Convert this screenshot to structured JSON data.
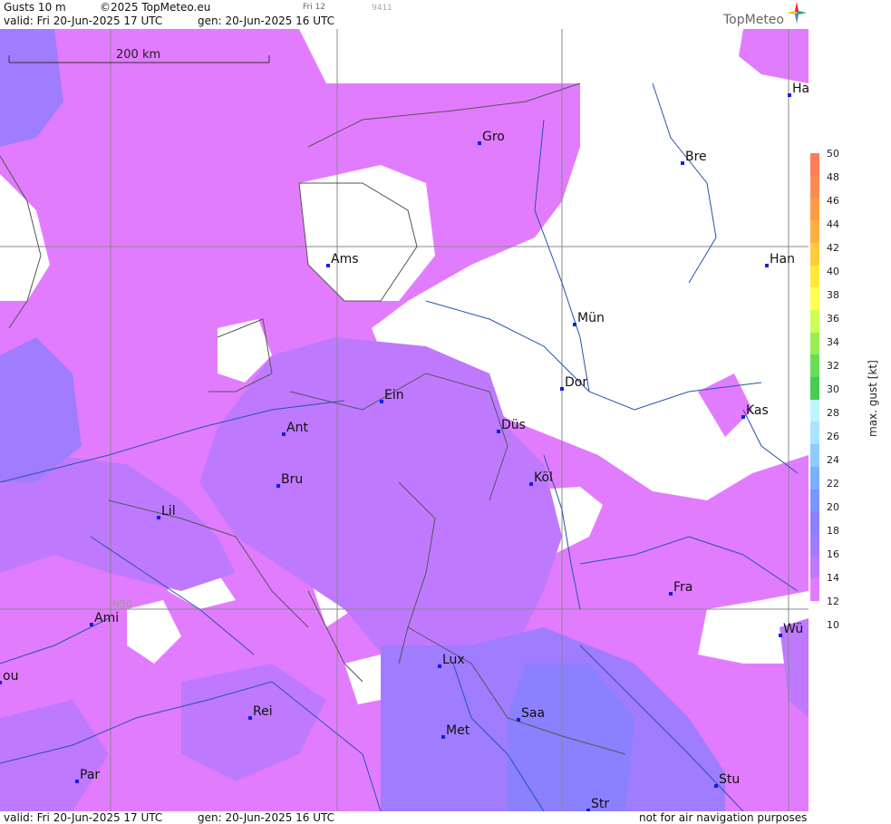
{
  "header": {
    "title": "Gusts 10 m",
    "copyright": "©2025 TopMeteo.eu",
    "valid": "valid:  Fri  20-Jun-2025  17 UTC",
    "gen": "gen: 20-Jun-2025 16 UTC",
    "time_mark": "Fri 12",
    "code": "9411",
    "logo": "TopMeteo"
  },
  "footer": {
    "valid": "valid:  Fri  20-Jun-2025  17 UTC",
    "gen": "gen: 20-Jun-2025 16 UTC",
    "disclaimer": "not for air navigation purposes"
  },
  "scale": {
    "label": "200 km"
  },
  "grid_label": "N50",
  "legend": {
    "title": "max. gust [kt]",
    "ticks": [
      "50",
      "48",
      "46",
      "44",
      "42",
      "40",
      "38",
      "36",
      "34",
      "32",
      "30",
      "28",
      "26",
      "24",
      "22",
      "20",
      "18",
      "16",
      "14",
      "12",
      "10"
    ],
    "colors": [
      "#ff7b5a",
      "#ff8a50",
      "#ff9a48",
      "#ffb040",
      "#ffcc3a",
      "#ffe83a",
      "#ffff50",
      "#ccff55",
      "#99ee55",
      "#66dd55",
      "#44cc55",
      "#bff4ff",
      "#a8e4ff",
      "#8ecbff",
      "#79b0ff",
      "#7a96ff",
      "#8b80ff",
      "#a07cff",
      "#bf79ff",
      "#e27cff"
    ]
  },
  "cities": [
    {
      "name": "Ha"
    },
    {
      "name": "Gro"
    },
    {
      "name": "Bre"
    },
    {
      "name": "Ams"
    },
    {
      "name": "Han"
    },
    {
      "name": "Mün"
    },
    {
      "name": "Dor"
    },
    {
      "name": "Ein"
    },
    {
      "name": "Kas"
    },
    {
      "name": "Ant"
    },
    {
      "name": "Düs"
    },
    {
      "name": "Bru"
    },
    {
      "name": "Köl"
    },
    {
      "name": "Lil"
    },
    {
      "name": "Fra"
    },
    {
      "name": "Ami"
    },
    {
      "name": "Wü"
    },
    {
      "name": "Lux"
    },
    {
      "name": "ou"
    },
    {
      "name": "Rei"
    },
    {
      "name": "Saa"
    },
    {
      "name": "Met"
    },
    {
      "name": "Stu"
    },
    {
      "name": "Par"
    },
    {
      "name": "Str"
    }
  ]
}
